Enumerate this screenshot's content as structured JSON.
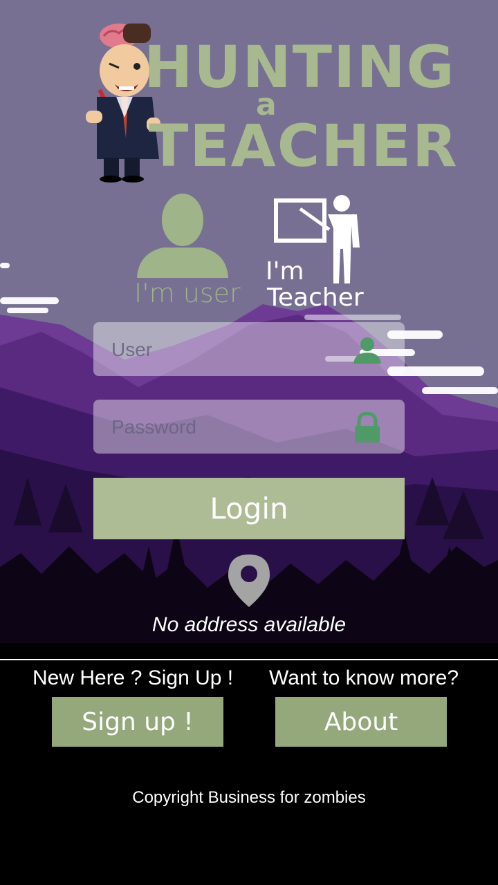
{
  "app": {
    "logo_line1": "HUNTING",
    "logo_line2": "a",
    "logo_line3": "TEACHER"
  },
  "roles": {
    "user_label": "I'm user",
    "teacher_label_line1": "I'm",
    "teacher_label_line2": "Teacher"
  },
  "form": {
    "user_placeholder": "User",
    "password_placeholder": "Password",
    "login_label": "Login"
  },
  "location": {
    "address_text": "No address available"
  },
  "footer": {
    "signup_prompt": "New Here ? Sign Up !",
    "signup_button": "Sign up !",
    "about_prompt": "Want to know more?",
    "about_button": "About",
    "copyright": "Copyright Business for zombies"
  },
  "colors": {
    "sky": "#777093",
    "accent_green": "#aebc96",
    "button_green": "#94a87b",
    "mountain_purple": "#5b2d82"
  }
}
